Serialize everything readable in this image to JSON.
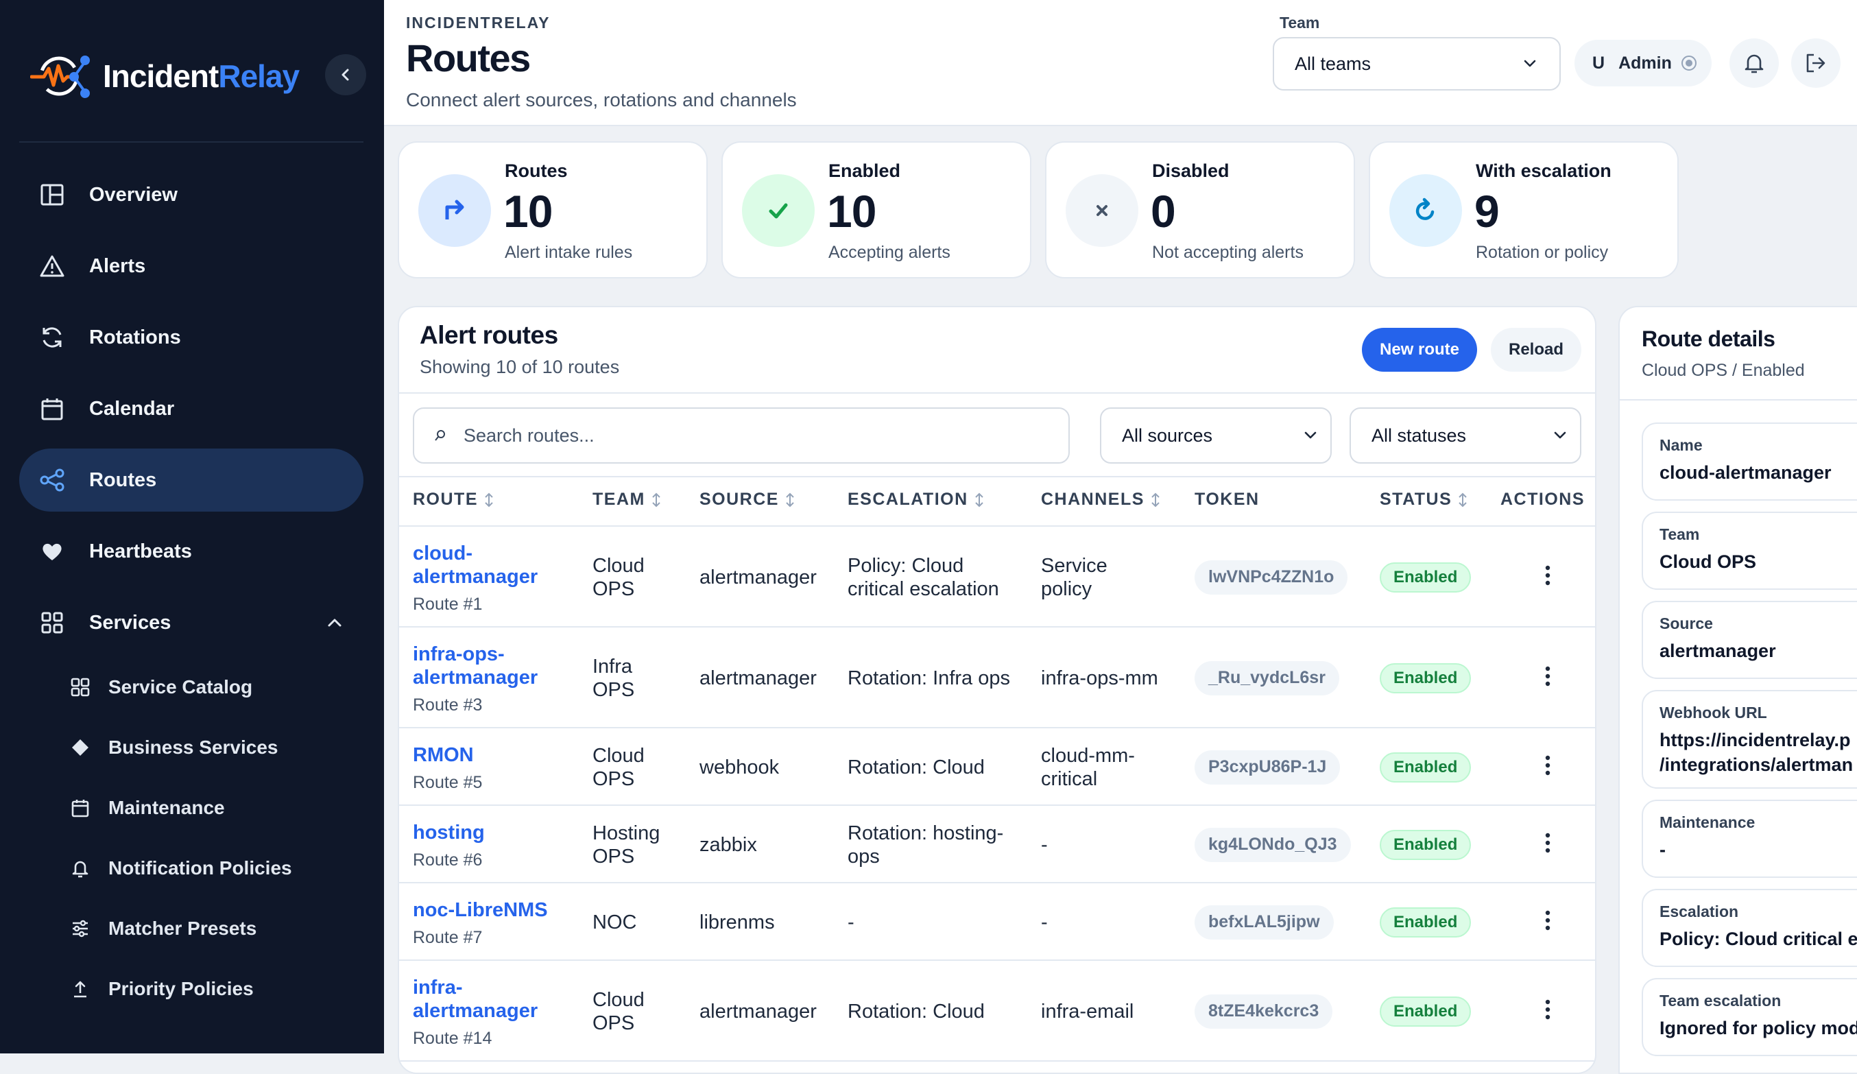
{
  "brand": {
    "name_main": "Incident",
    "name_accent": "Relay"
  },
  "nav": {
    "items": [
      {
        "label": "Overview",
        "icon": "layout-icon"
      },
      {
        "label": "Alerts",
        "icon": "warning-triangle-icon"
      },
      {
        "label": "Rotations",
        "icon": "refresh-icon"
      },
      {
        "label": "Calendar",
        "icon": "calendar-icon"
      },
      {
        "label": "Routes",
        "icon": "route-icon",
        "active": true
      },
      {
        "label": "Heartbeats",
        "icon": "heart-icon"
      },
      {
        "label": "Services",
        "icon": "grid-icon",
        "expanded": true
      }
    ],
    "sub_items": [
      {
        "label": "Service Catalog",
        "icon": "grid-icon"
      },
      {
        "label": "Business Services",
        "icon": "diamond-icon"
      },
      {
        "label": "Maintenance",
        "icon": "calendar-icon"
      },
      {
        "label": "Notification Policies",
        "icon": "bell-icon"
      },
      {
        "label": "Matcher Presets",
        "icon": "sliders-icon"
      },
      {
        "label": "Priority Policies",
        "icon": "upload-arrow-icon"
      }
    ]
  },
  "header": {
    "eyebrow": "INCIDENTRELAY",
    "title": "Routes",
    "subtitle": "Connect alert sources, rotations and channels",
    "team_label": "Team",
    "team_value": "All teams",
    "user_initial": "U",
    "user_name": "Admin"
  },
  "stats": [
    {
      "label": "Routes",
      "value": "10",
      "hint": "Alert intake rules",
      "icon": "route-arrow-icon",
      "bg": "#dbeafe",
      "fg": "#2563eb"
    },
    {
      "label": "Enabled",
      "value": "10",
      "hint": "Accepting alerts",
      "icon": "check-icon",
      "bg": "#dcfce7",
      "fg": "#16a34a"
    },
    {
      "label": "Disabled",
      "value": "0",
      "hint": "Not accepting alerts",
      "icon": "x-icon",
      "bg": "#f1f5f9",
      "fg": "#64748b"
    },
    {
      "label": "With escalation",
      "value": "9",
      "hint": "Rotation or policy",
      "icon": "rotate-icon",
      "bg": "#e0f2fe",
      "fg": "#0284c7"
    }
  ],
  "routes_panel": {
    "title": "Alert routes",
    "subtitle": "Showing 10 of 10 routes",
    "new_button": "New route",
    "reload_button": "Reload",
    "search_placeholder": "Search routes...",
    "source_filter": "All sources",
    "status_filter": "All statuses",
    "columns": [
      "ROUTE",
      "TEAM",
      "SOURCE",
      "ESCALATION",
      "CHANNELS",
      "TOKEN",
      "STATUS",
      "ACTIONS"
    ],
    "rows": [
      {
        "name_lines": [
          "cloud-",
          "alertmanager"
        ],
        "id": "Route #1",
        "team_lines": [
          "Cloud",
          "OPS"
        ],
        "source": "alertmanager",
        "escalation_lines": [
          "Policy: Cloud",
          "critical escalation"
        ],
        "channels_lines": [
          "Service",
          "policy"
        ],
        "token": "lwVNPc4ZZN1o",
        "status": "Enabled"
      },
      {
        "name_lines": [
          "infra-ops-",
          "alertmanager"
        ],
        "id": "Route #3",
        "team_lines": [
          "Infra",
          "OPS"
        ],
        "source": "alertmanager",
        "escalation_lines": [
          "Rotation: Infra ops"
        ],
        "channels_lines": [
          "infra-ops-mm"
        ],
        "token": "_Ru_vydcL6sr",
        "status": "Enabled"
      },
      {
        "name_lines": [
          "RMON"
        ],
        "id": "Route #5",
        "team_lines": [
          "Cloud",
          "OPS"
        ],
        "source": "webhook",
        "escalation_lines": [
          "Rotation: Cloud"
        ],
        "channels_lines": [
          "cloud-mm-",
          "critical"
        ],
        "token": "P3cxpU86P-1J",
        "status": "Enabled"
      },
      {
        "name_lines": [
          "hosting"
        ],
        "id": "Route #6",
        "team_lines": [
          "Hosting",
          "OPS"
        ],
        "source": "zabbix",
        "escalation_lines": [
          "Rotation: hosting-",
          "ops"
        ],
        "channels_lines": [
          "-"
        ],
        "token": "kg4LONdo_QJ3",
        "status": "Enabled"
      },
      {
        "name_lines": [
          "noc-LibreNMS"
        ],
        "id": "Route #7",
        "team_lines": [
          "NOC"
        ],
        "source": "librenms",
        "escalation_lines": [
          "-"
        ],
        "channels_lines": [
          "-"
        ],
        "token": "befxLAL5jipw",
        "status": "Enabled"
      },
      {
        "name_lines": [
          "infra-",
          "alertmanager"
        ],
        "id": "Route #14",
        "team_lines": [
          "Cloud",
          "OPS"
        ],
        "source": "alertmanager",
        "escalation_lines": [
          "Rotation: Cloud"
        ],
        "channels_lines": [
          "infra-email"
        ],
        "token": "8tZE4kekcrc3",
        "status": "Enabled"
      }
    ]
  },
  "details": {
    "title": "Route details",
    "subtitle": "Cloud OPS / Enabled",
    "fields": [
      {
        "label": "Name",
        "value": "cloud-alertmanager"
      },
      {
        "label": "Team",
        "value": "Cloud OPS"
      },
      {
        "label": "Source",
        "value": "alertmanager"
      },
      {
        "label": "Webhook URL",
        "value": "https://incidentrelay.p",
        "value2": "/integrations/alertman"
      },
      {
        "label": "Maintenance",
        "value": "-"
      },
      {
        "label": "Escalation",
        "value": "Policy: Cloud critical es"
      },
      {
        "label": "Team escalation",
        "value": "Ignored for policy mode"
      }
    ]
  },
  "colors": {
    "accent": "#2563eb",
    "sidebar": "#0f1729",
    "sidebar_active": "#1c3258",
    "enabled": "#15803d"
  }
}
